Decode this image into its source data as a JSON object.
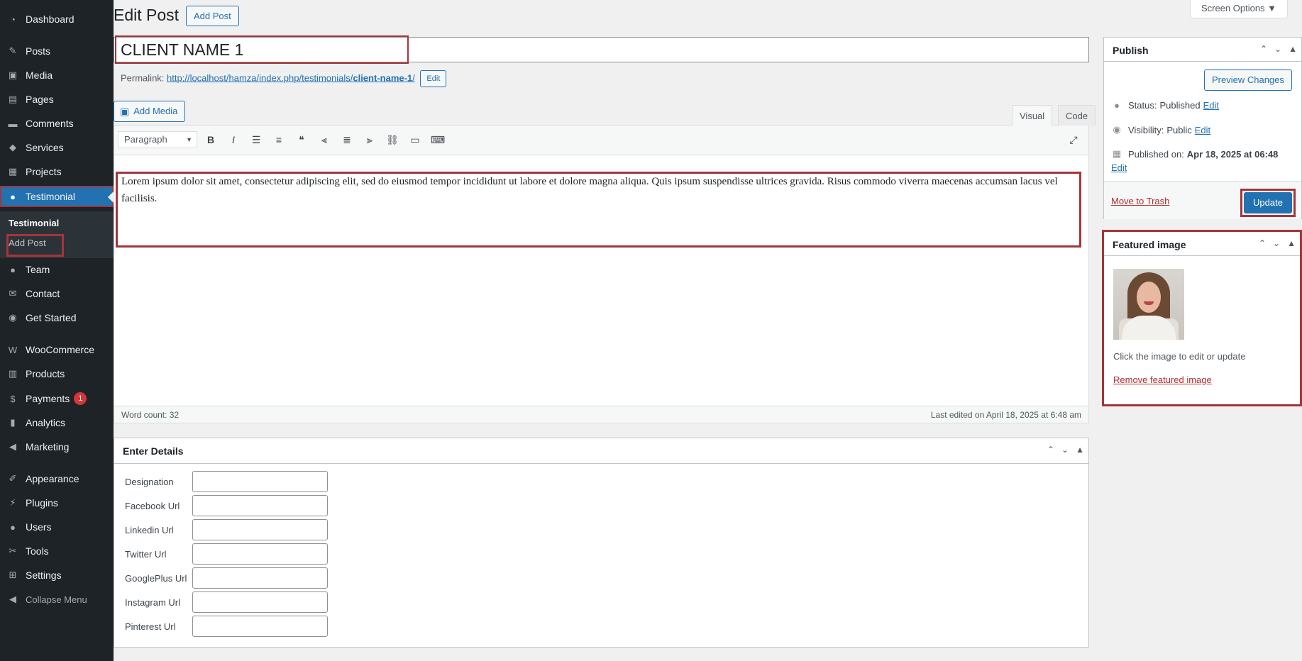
{
  "sidebar": {
    "items": [
      {
        "label": "Dashboard",
        "icon": "dashboard-icon",
        "glyph": "◔"
      },
      {
        "label": "Posts",
        "icon": "pin-icon",
        "glyph": "✎"
      },
      {
        "label": "Media",
        "icon": "media-icon",
        "glyph": "▣"
      },
      {
        "label": "Pages",
        "icon": "pages-icon",
        "glyph": "▤"
      },
      {
        "label": "Comments",
        "icon": "comment-icon",
        "glyph": "▬"
      },
      {
        "label": "Services",
        "icon": "tag-icon",
        "glyph": "◆"
      },
      {
        "label": "Projects",
        "icon": "portfolio-icon",
        "glyph": "▦"
      },
      {
        "label": "Testimonial",
        "icon": "user-icon",
        "glyph": "●"
      },
      {
        "label": "Team",
        "icon": "user-icon",
        "glyph": "●"
      },
      {
        "label": "Contact",
        "icon": "email-icon",
        "glyph": "✉"
      },
      {
        "label": "Get Started",
        "icon": "globe-icon",
        "glyph": "◉"
      },
      {
        "label": "WooCommerce",
        "icon": "woocommerce-icon",
        "glyph": "W"
      },
      {
        "label": "Products",
        "icon": "archive-icon",
        "glyph": "▥"
      },
      {
        "label": "Payments",
        "icon": "dollar-icon",
        "glyph": "$",
        "badge": "1"
      },
      {
        "label": "Analytics",
        "icon": "chart-bar-icon",
        "glyph": "▮"
      },
      {
        "label": "Marketing",
        "icon": "megaphone-icon",
        "glyph": "◀"
      },
      {
        "label": "Appearance",
        "icon": "brush-icon",
        "glyph": "✐"
      },
      {
        "label": "Plugins",
        "icon": "plugin-icon",
        "glyph": "⚡"
      },
      {
        "label": "Users",
        "icon": "users-icon",
        "glyph": "●"
      },
      {
        "label": "Tools",
        "icon": "wrench-icon",
        "glyph": "✂"
      },
      {
        "label": "Settings",
        "icon": "settings-icon",
        "glyph": "⊞"
      }
    ],
    "submenu": {
      "current": "Testimonial",
      "add": "Add Post"
    },
    "collapse_label": "Collapse Menu"
  },
  "header": {
    "title": "Edit Post",
    "add_post_label": "Add Post",
    "screen_options_label": "Screen Options ▼"
  },
  "post": {
    "title": "CLIENT NAME 1",
    "permalink_label": "Permalink:",
    "permalink_base": "http://localhost/hamza/index.php/testimonials/",
    "permalink_slug": "client-name-1",
    "permalink_trailing": "/",
    "permalink_edit": "Edit",
    "content": "Lorem ipsum dolor sit amet, consectetur adipiscing elit, sed do eiusmod tempor incididunt ut labore et dolore magna aliqua. Quis ipsum suspendisse ultrices gravida. Risus commodo viverra maecenas accumsan lacus vel facilisis."
  },
  "editor": {
    "add_media_label": "Add Media",
    "tab_visual": "Visual",
    "tab_code": "Code",
    "format_value": "Paragraph",
    "word_count": "Word count: 32",
    "last_edited": "Last edited on April 18, 2025 at 6:48 am",
    "toolbar": [
      {
        "name": "bold-icon",
        "glyph": "B"
      },
      {
        "name": "italic-icon",
        "glyph": "I"
      },
      {
        "name": "bullet-list-icon",
        "glyph": "☰"
      },
      {
        "name": "numbered-list-icon",
        "glyph": "≡"
      },
      {
        "name": "blockquote-icon",
        "glyph": "❝"
      },
      {
        "name": "align-left-icon",
        "glyph": "⫷"
      },
      {
        "name": "align-center-icon",
        "glyph": "≣"
      },
      {
        "name": "align-right-icon",
        "glyph": "⫸"
      },
      {
        "name": "link-icon",
        "glyph": "⛓"
      },
      {
        "name": "read-more-icon",
        "glyph": "▭"
      },
      {
        "name": "toolbar-toggle-icon",
        "glyph": "⌨"
      }
    ],
    "fullscreen_glyph": "⤢"
  },
  "details": {
    "title": "Enter Details",
    "fields": [
      {
        "label": "Designation",
        "value": ""
      },
      {
        "label": "Facebook Url",
        "value": ""
      },
      {
        "label": "Linkedin Url",
        "value": ""
      },
      {
        "label": "Twitter Url",
        "value": ""
      },
      {
        "label": "GooglePlus Url",
        "value": ""
      },
      {
        "label": "Instagram Url",
        "value": ""
      },
      {
        "label": "Pinterest Url",
        "value": ""
      }
    ]
  },
  "publish": {
    "title": "Publish",
    "preview_label": "Preview Changes",
    "status_label": "Status:",
    "status_value": "Published",
    "visibility_label": "Visibility:",
    "visibility_value": "Public",
    "published_on_label": "Published on:",
    "published_on_value": "Apr 18, 2025 at 06:48",
    "edit_label": "Edit",
    "trash_label": "Move to Trash",
    "update_label": "Update"
  },
  "featured": {
    "title": "Featured image",
    "hint": "Click the image to edit or update",
    "remove_label": "Remove featured image"
  },
  "colors": {
    "sidebar_bg": "#1d2327",
    "accent": "#2271b1",
    "highlight": "#a4353a",
    "danger": "#b32d2e"
  }
}
